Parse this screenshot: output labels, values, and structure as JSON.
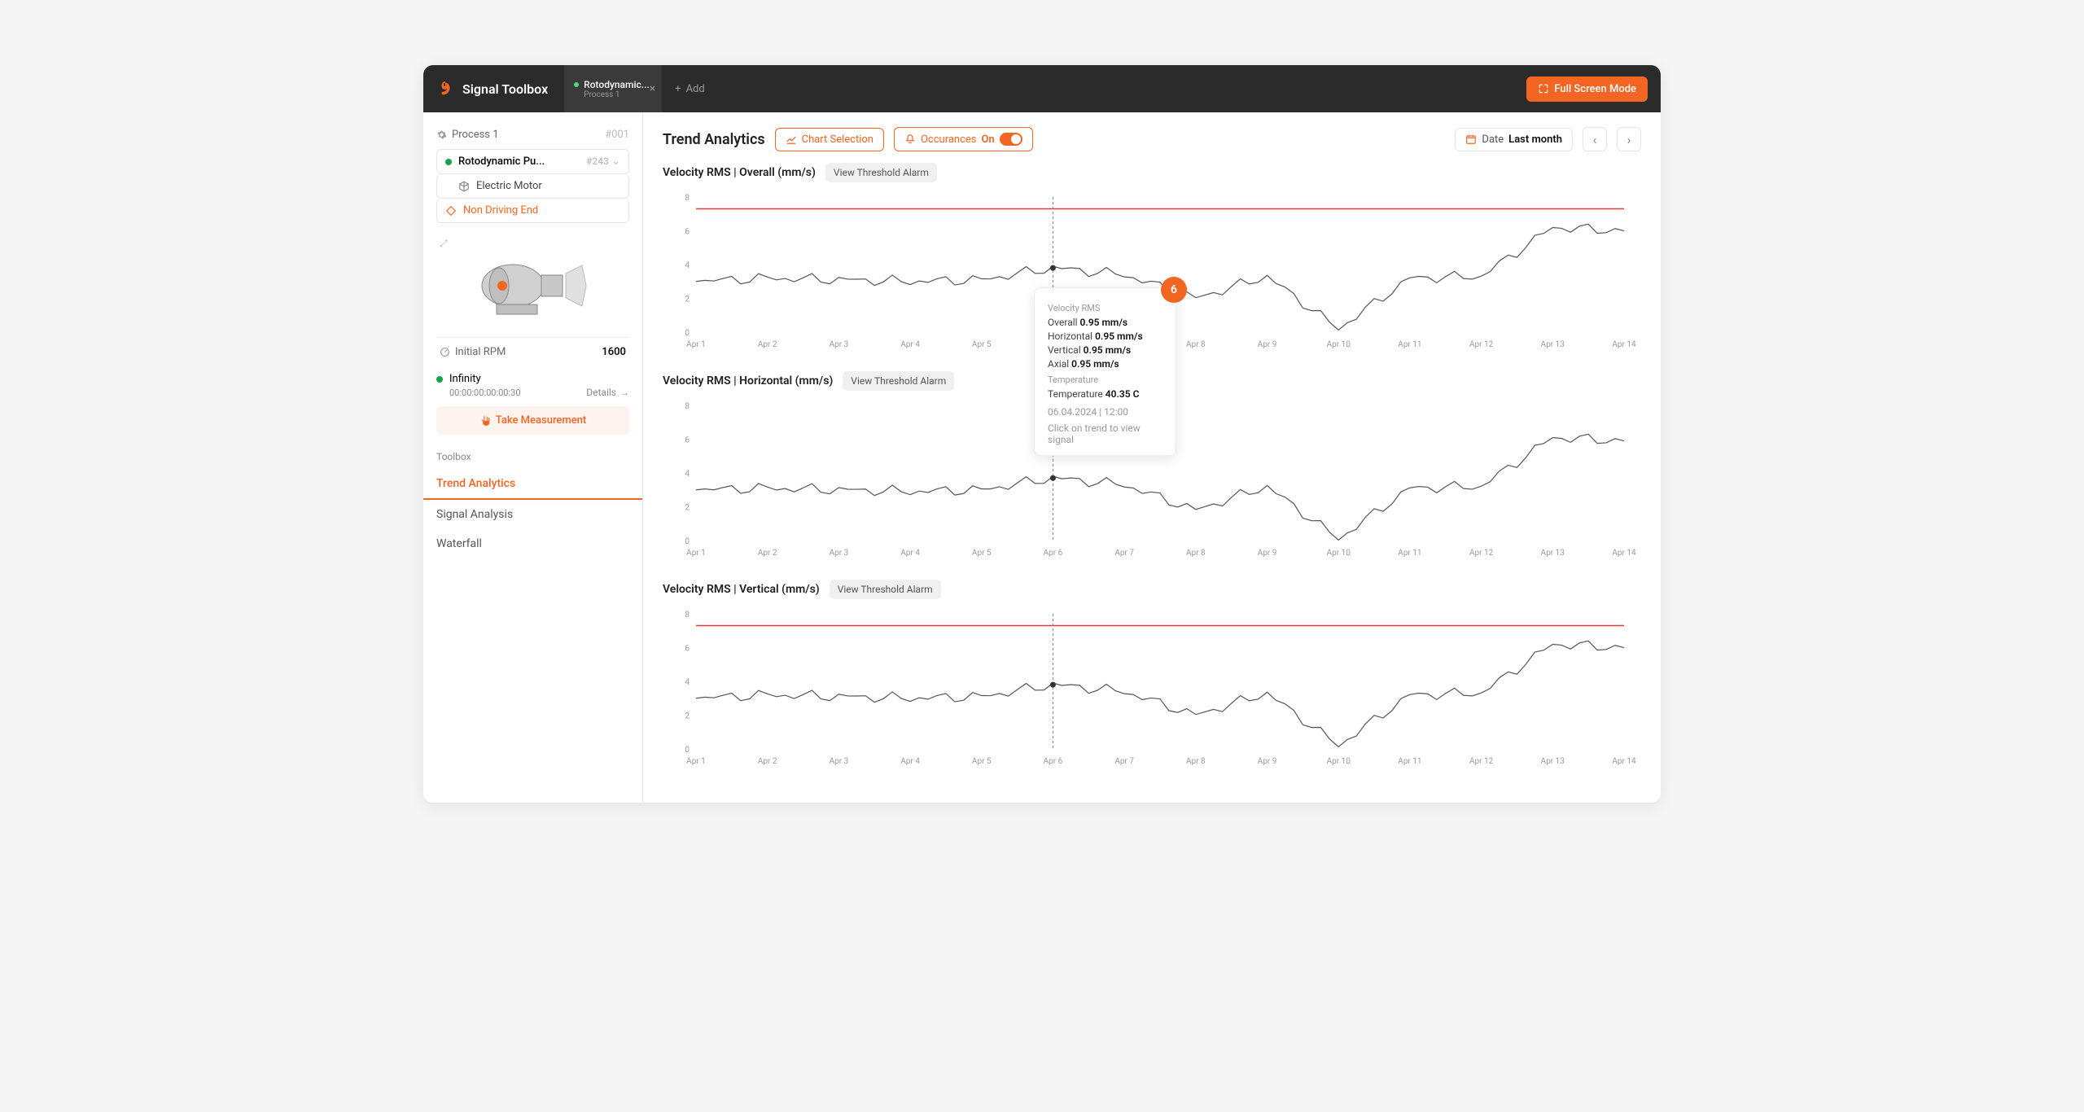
{
  "header": {
    "app_title": "Signal Toolbox",
    "tab": {
      "title": "Rotodynamic...",
      "subtitle": "Process 1"
    },
    "add_label": "Add",
    "fullscreen_label": "Full Screen Mode"
  },
  "sidebar": {
    "process_label": "Process 1",
    "process_id": "#001",
    "tree": {
      "root": "Rotodynamic Pu...",
      "root_id": "#243",
      "child1": "Electric Motor",
      "child2": "Non Driving End"
    },
    "rpm_label": "Initial RPM",
    "rpm_value": "1600",
    "infinity": "Infinity",
    "timecode": "00:00:00:00:00:30",
    "details_label": "Details",
    "take_measurement": "Take Measurement",
    "toolbox_label": "Toolbox",
    "nav": {
      "trend": "Trend Analytics",
      "signal": "Signal Analysis",
      "waterfall": "Waterfall"
    }
  },
  "main": {
    "title": "Trend Analytics",
    "chart_selection": "Chart Selection",
    "occurances_label": "Occurances",
    "occurances_state": "On",
    "date_label": "Date",
    "date_value": "Last month",
    "threshold_btn": "View Threshold Alarm",
    "chart1_title": "Velocity RMS | Overall (mm/s)",
    "chart2_title": "Velocity RMS | Horizontal (mm/s)",
    "chart3_title": "Velocity RMS | Vertical (mm/s)",
    "badge": "6"
  },
  "tooltip": {
    "section1": "Velocity RMS",
    "overall_label": "Overall",
    "overall_val": "0.95 mm/s",
    "horizontal_label": "Horizontal",
    "horizontal_val": "0.95 mm/s",
    "vertical_label": "Vertical",
    "vertical_val": "0.95 mm/s",
    "axial_label": "Axial",
    "axial_val": "0.95 mm/s",
    "section2": "Temperature",
    "temp_label": "Temperature",
    "temp_val": "40.35 C",
    "timestamp": "06.04.2024 | 12:00",
    "hint": "Click on trend to view signal"
  },
  "chart_data": [
    {
      "type": "line",
      "title": "Velocity RMS | Overall (mm/s)",
      "ylabel": "",
      "ylim": [
        0,
        8
      ],
      "yticks": [
        0,
        2,
        4,
        6,
        8
      ],
      "threshold": 7.3,
      "categories": [
        "Apr 1",
        "Apr 2",
        "Apr 3",
        "Apr 4",
        "Apr 5",
        "Apr 6",
        "Apr 7",
        "Apr 8",
        "Apr 9",
        "Apr 10",
        "Apr 11",
        "Apr 12",
        "Apr 13",
        "Apr 14"
      ],
      "values": [
        3.0,
        3.2,
        3.1,
        3.0,
        3.1,
        3.8,
        3.4,
        2.0,
        3.3,
        0.2,
        3.2,
        3.3,
        6.2,
        6.0
      ]
    },
    {
      "type": "line",
      "title": "Velocity RMS | Horizontal (mm/s)",
      "ylabel": "",
      "ylim": [
        0,
        8
      ],
      "yticks": [
        0,
        2,
        4,
        6,
        8
      ],
      "categories": [
        "Apr 1",
        "Apr 2",
        "Apr 3",
        "Apr 4",
        "Apr 5",
        "Apr 6",
        "Apr 7",
        "Apr 8",
        "Apr 9",
        "Apr 10",
        "Apr 11",
        "Apr 12",
        "Apr 13",
        "Apr 14"
      ],
      "values": [
        3.0,
        3.1,
        3.0,
        2.9,
        3.0,
        3.7,
        3.3,
        1.8,
        3.2,
        0.1,
        3.1,
        3.2,
        6.1,
        5.9
      ]
    },
    {
      "type": "line",
      "title": "Velocity RMS | Vertical (mm/s)",
      "ylabel": "",
      "ylim": [
        0,
        8
      ],
      "yticks": [
        0,
        2,
        4,
        6,
        8
      ],
      "threshold": 7.3,
      "categories": [
        "Apr 1",
        "Apr 2",
        "Apr 3",
        "Apr 4",
        "Apr 5",
        "Apr 6",
        "Apr 7",
        "Apr 8",
        "Apr 9",
        "Apr 10",
        "Apr 11",
        "Apr 12",
        "Apr 13",
        "Apr 14"
      ],
      "values": [
        3.0,
        3.2,
        3.1,
        3.0,
        3.1,
        3.8,
        3.4,
        2.0,
        3.3,
        0.2,
        3.2,
        3.3,
        6.2,
        6.0
      ]
    }
  ]
}
